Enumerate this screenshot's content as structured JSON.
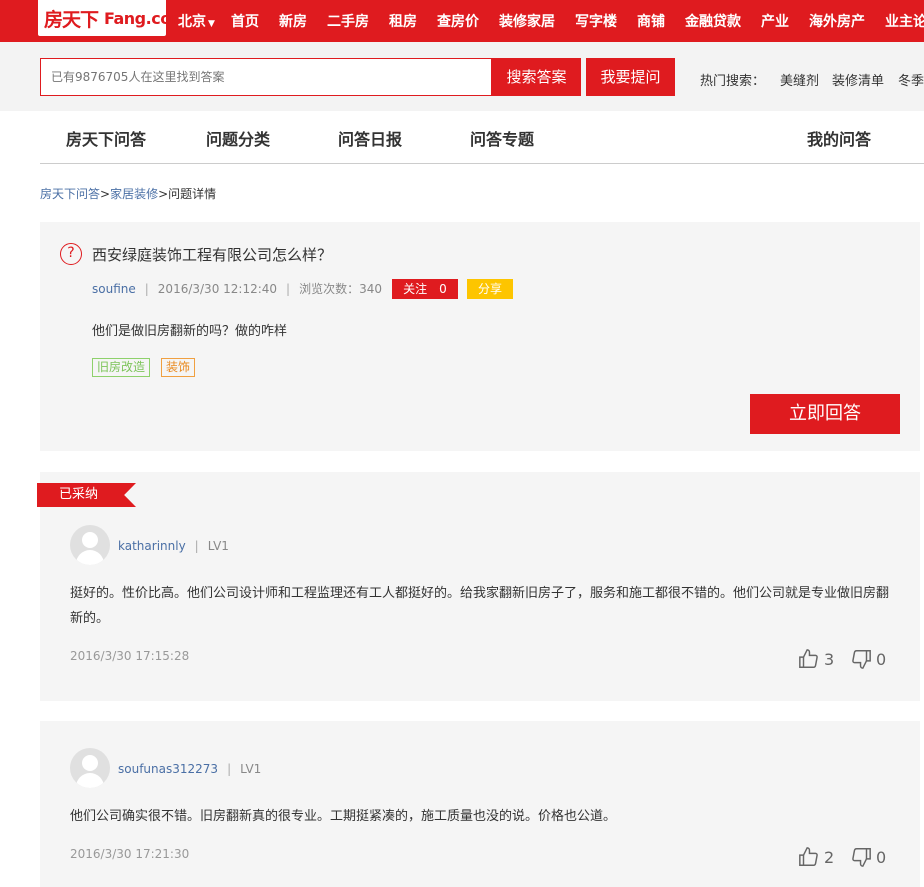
{
  "header": {
    "logo_cn": "房天下",
    "logo_en": "Fang.com",
    "city": "北京",
    "nav": [
      "首页",
      "新房",
      "二手房",
      "租房",
      "查房价",
      "装修家居",
      "写字楼",
      "商铺",
      "金融贷款",
      "产业",
      "海外房产",
      "业主论"
    ]
  },
  "search": {
    "placeholder": "已有9876705人在这里找到答案",
    "search_btn": "搜索答案",
    "ask_btn": "我要提问",
    "hot_label": "热门搜索：",
    "hot_words": [
      "美缝剂",
      "装修清单",
      "冬季"
    ]
  },
  "subnav": {
    "items": [
      "房天下问答",
      "问题分类",
      "问答日报",
      "问答专题"
    ],
    "my": "我的问答"
  },
  "breadcrumb": {
    "home": "房天下问答",
    "sep1": ">",
    "cat": "家居装修",
    "sep2": ">",
    "current": "问题详情"
  },
  "question": {
    "title": "西安绿庭装饰工程有限公司怎么样？",
    "user": "soufine",
    "time": "2016/3/30 12:12:40",
    "views": "浏览次数：340",
    "follow": "关注　0",
    "share": "分享",
    "body": "他们是做旧房翻新的吗？做的咋样",
    "tags": [
      "旧房改造",
      "装饰"
    ],
    "answer_btn": "立即回答"
  },
  "answers": [
    {
      "adopted": "已采纳",
      "user": "katharinnly",
      "level": "LV1",
      "text": "挺好的。性价比高。他们公司设计师和工程监理还有工人都挺好的。给我家翻新旧房子了，服务和施工都很不错的。他们公司就是专业做旧房翻新的。",
      "time": "2016/3/30 17:15:28",
      "up": "3",
      "down": "0"
    },
    {
      "user": "soufunas312273",
      "level": "LV1",
      "text": "他们公司确实很不错。旧房翻新真的很专业。工期挺紧凑的，施工质量也没的说。价格也公道。",
      "time": "2016/3/30 17:21:30",
      "up": "2",
      "down": "0"
    }
  ],
  "colors": {
    "brand_red": "#df1b1f",
    "link_blue": "#4a6fa5",
    "share_yellow": "#fdc500"
  }
}
